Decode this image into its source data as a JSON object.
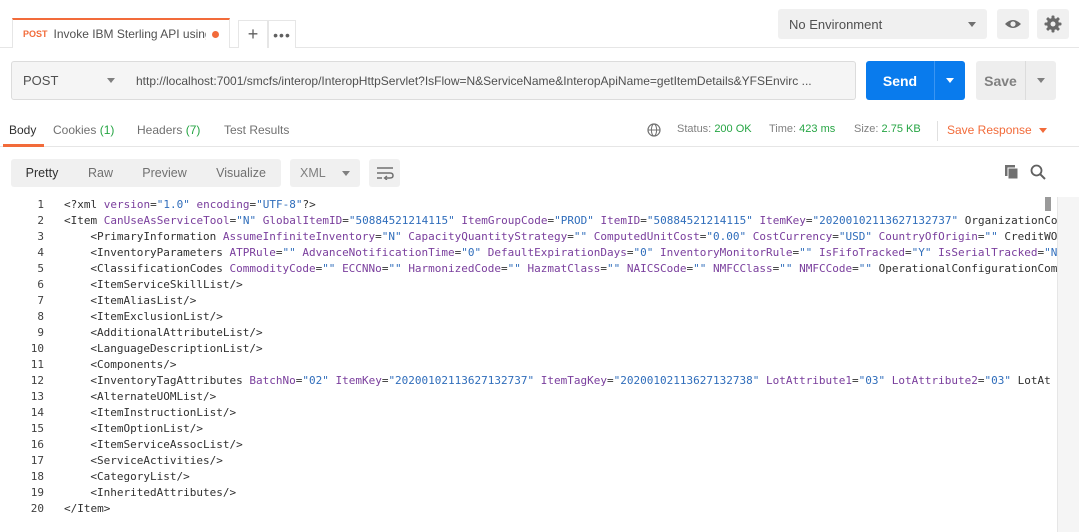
{
  "request_tab": {
    "method": "POST",
    "title": "Invoke IBM Sterling API using ...",
    "add_label": "+",
    "more_label": "•••"
  },
  "environment": {
    "selected": "No Environment"
  },
  "url_bar": {
    "method": "POST",
    "url": "http://localhost:7001/smcfs/interop/InteropHttpServlet?IsFlow=N&ServiceName&InteropApiName=getItemDetails&YFSEnvirc ...",
    "send_label": "Send",
    "save_label": "Save"
  },
  "response_tabs": [
    {
      "label": "Body",
      "count": ""
    },
    {
      "label": "Cookies",
      "count": "(1)"
    },
    {
      "label": "Headers",
      "count": "(7)"
    },
    {
      "label": "Test Results",
      "count": ""
    }
  ],
  "status": {
    "status_label": "Status:",
    "status_value": "200 OK",
    "time_label": "Time:",
    "time_value": "423 ms",
    "size_label": "Size:",
    "size_value": "2.75 KB",
    "save_response_label": "Save Response"
  },
  "view_modes": [
    "Pretty",
    "Raw",
    "Preview",
    "Visualize"
  ],
  "format": "XML",
  "colors": {
    "accent": "#f26b3a",
    "send_blue": "#097bed",
    "success_green": "#26a544",
    "xml_attr": "#7a3e9d",
    "xml_value": "#2f6dbb"
  },
  "code_lines": [
    {
      "num": "1",
      "indent": 0,
      "raw": "<?xml version=\"1.0\" encoding=\"UTF-8\"?>"
    },
    {
      "num": "2",
      "indent": 0,
      "raw": "<Item CanUseAsServiceTool=\"N\" GlobalItemID=\"50884521214115\" ItemGroupCode=\"PROD\" ItemID=\"50884521214115\" ItemKey=\"20200102113627132737\" OrganizationCo"
    },
    {
      "num": "3",
      "indent": 4,
      "raw": "<PrimaryInformation AssumeInfiniteInventory=\"N\" CapacityQuantityStrategy=\"\" ComputedUnitCost=\"0.00\" CostCurrency=\"USD\" CountryOfOrigin=\"\" CreditWOR"
    },
    {
      "num": "4",
      "indent": 4,
      "raw": "<InventoryParameters ATPRule=\"\" AdvanceNotificationTime=\"0\" DefaultExpirationDays=\"0\" InventoryMonitorRule=\"\" IsFifoTracked=\"Y\" IsSerialTracked=\"N\""
    },
    {
      "num": "5",
      "indent": 4,
      "raw": "<ClassificationCodes CommodityCode=\"\" ECCNNo=\"\" HarmonizedCode=\"\" HazmatClass=\"\" NAICSCode=\"\" NMFCClass=\"\" NMFCCode=\"\" OperationalConfigurationComp"
    },
    {
      "num": "6",
      "indent": 4,
      "raw": "<ItemServiceSkillList/>"
    },
    {
      "num": "7",
      "indent": 4,
      "raw": "<ItemAliasList/>"
    },
    {
      "num": "8",
      "indent": 4,
      "raw": "<ItemExclusionList/>"
    },
    {
      "num": "9",
      "indent": 4,
      "raw": "<AdditionalAttributeList/>"
    },
    {
      "num": "10",
      "indent": 4,
      "raw": "<LanguageDescriptionList/>"
    },
    {
      "num": "11",
      "indent": 4,
      "raw": "<Components/>"
    },
    {
      "num": "12",
      "indent": 4,
      "raw": "<InventoryTagAttributes BatchNo=\"02\" ItemKey=\"20200102113627132737\" ItemTagKey=\"20200102113627132738\" LotAttribute1=\"03\" LotAttribute2=\"03\" LotAt"
    },
    {
      "num": "13",
      "indent": 4,
      "raw": "<AlternateUOMList/>"
    },
    {
      "num": "14",
      "indent": 4,
      "raw": "<ItemInstructionList/>"
    },
    {
      "num": "15",
      "indent": 4,
      "raw": "<ItemOptionList/>"
    },
    {
      "num": "16",
      "indent": 4,
      "raw": "<ItemServiceAssocList/>"
    },
    {
      "num": "17",
      "indent": 4,
      "raw": "<ServiceActivities/>"
    },
    {
      "num": "18",
      "indent": 4,
      "raw": "<CategoryList/>"
    },
    {
      "num": "19",
      "indent": 4,
      "raw": "<InheritedAttributes/>"
    },
    {
      "num": "20",
      "indent": 0,
      "raw": "</Item>"
    }
  ]
}
